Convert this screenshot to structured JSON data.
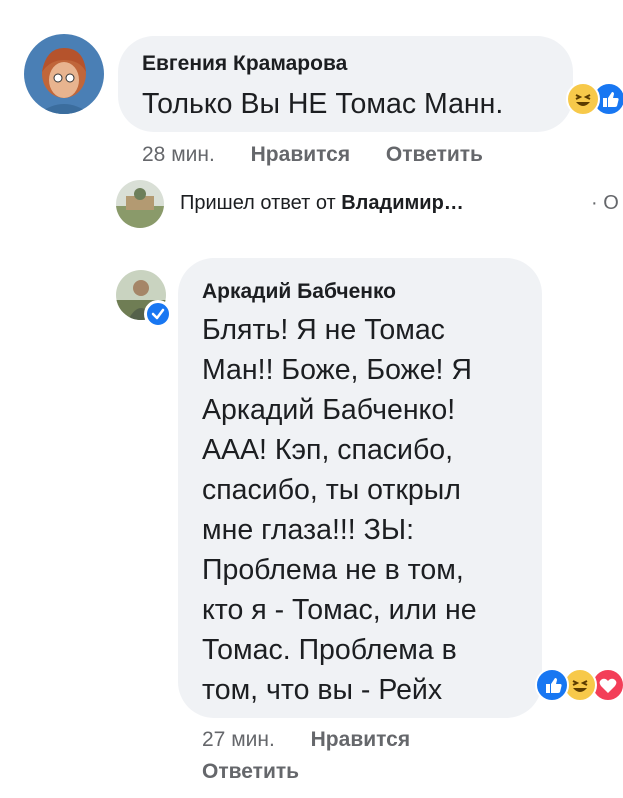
{
  "comment1": {
    "author": "Евгения Крамарова",
    "text": "Только Вы НЕ Томас Манн.",
    "time": "28 мин.",
    "like_label": "Нравится",
    "reply_label": "Ответить"
  },
  "reply_summary": {
    "prefix": "Пришел ответ от ",
    "name": "Владимир…",
    "trailing": "· О"
  },
  "comment2": {
    "author": "Аркадий Бабченко",
    "lines": [
      "Блять! Я не Томас",
      "Ман!! Боже, Боже! Я",
      "Аркадий Бабченко!",
      "ААА! Кэп, спасибо,",
      "спасибо, ты открыл",
      "мне глаза!!! ЗЫ:",
      "Проблема не в том,",
      "кто я - Томас, или не",
      "Томас. Проблема в",
      "том, что вы - Рейх"
    ],
    "time": "27 мин.",
    "like_label": "Нравится",
    "reply_label": "Ответить"
  },
  "colors": {
    "bubble": "#f0f2f5",
    "meta": "#65676b",
    "like_blue": "#1877f2",
    "haha_yellow": "#f7c94a",
    "love_red": "#f33e58"
  },
  "icons": [
    "like-reaction-icon",
    "haha-reaction-icon",
    "love-reaction-icon",
    "verified-badge-icon"
  ]
}
